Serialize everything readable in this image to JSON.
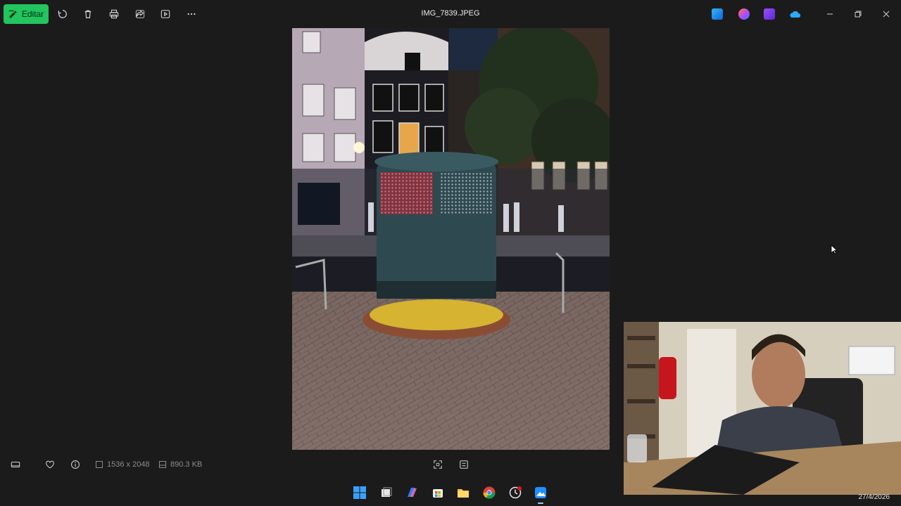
{
  "toolbar": {
    "edit_label": "Editar",
    "file_name": "IMG_7839.JPEG"
  },
  "toolbar_icons": [
    "rotate-icon",
    "delete-icon",
    "print-icon",
    "share-icon",
    "slideshow-icon",
    "more-icon"
  ],
  "app_icons": [
    "photos-app-icon",
    "copilot-app-icon",
    "clipchamp-app-icon",
    "onedrive-app-icon"
  ],
  "bottom_bar": {
    "dimensions": "1536 x 2048",
    "file_size": "890.3 KB"
  },
  "taskbar": {
    "clock": "27/4/2026",
    "apps": [
      "start-icon",
      "task-view-icon",
      "copilot-icon",
      "store-icon",
      "file-explorer-icon",
      "chrome-icon",
      "clock-app-icon",
      "photos-icon"
    ]
  },
  "colors": {
    "accent": "#22c55e",
    "background": "#1c1b1b"
  }
}
